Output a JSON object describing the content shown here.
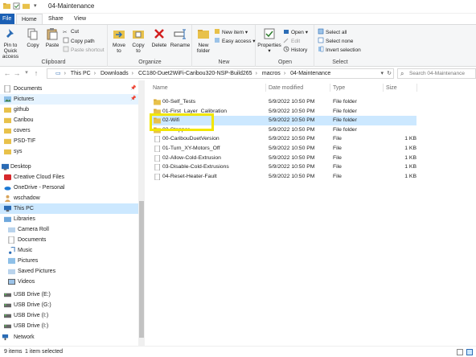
{
  "window": {
    "title": "04-Maintenance"
  },
  "tabs": [
    {
      "label": "File"
    },
    {
      "label": "Home"
    },
    {
      "label": "Share"
    },
    {
      "label": "View"
    }
  ],
  "ribbon": {
    "clipboard": {
      "label": "Clipboard",
      "pin": "Pin to Quick access",
      "copy": "Copy",
      "paste": "Paste",
      "cut": "Cut",
      "copy_path": "Copy path",
      "paste_shortcut": "Paste shortcut"
    },
    "organize": {
      "label": "Organize",
      "move_to": "Move to",
      "copy_to": "Copy to",
      "delete": "Delete",
      "rename": "Rename"
    },
    "new": {
      "label": "New",
      "new_folder": "New folder",
      "new_item": "New item",
      "easy_access": "Easy access"
    },
    "open": {
      "label": "Open",
      "properties": "Properties",
      "open": "Open",
      "edit": "Edit",
      "history": "History"
    },
    "select": {
      "label": "Select",
      "select_all": "Select all",
      "select_none": "Select none",
      "invert": "Invert selection"
    }
  },
  "address": {
    "crumbs": [
      "This PC",
      "Downloads",
      "CC180-Duet2WiFi-Caribou320-NSP-Build265",
      "macros",
      "04-Maintenance"
    ],
    "search_placeholder": "Search 04-Maintenance"
  },
  "nav": {
    "items": [
      {
        "label": "Documents",
        "icon": "documents-icon",
        "pinned": true
      },
      {
        "label": "Pictures",
        "icon": "pictures-icon",
        "pinned": true,
        "selected_light": true
      },
      {
        "label": "github",
        "icon": "folder-icon"
      },
      {
        "label": "Caribou",
        "icon": "folder-icon"
      },
      {
        "label": "covers",
        "icon": "folder-icon"
      },
      {
        "label": "PSD-TIF",
        "icon": "folder-icon"
      },
      {
        "label": "sys",
        "icon": "folder-icon"
      },
      {
        "label": "Desktop",
        "icon": "desktop-icon"
      },
      {
        "label": "Creative Cloud Files",
        "icon": "creative-cloud-icon"
      },
      {
        "label": "OneDrive - Personal",
        "icon": "onedrive-icon"
      },
      {
        "label": "wschadow",
        "icon": "user-icon"
      },
      {
        "label": "This PC",
        "icon": "pc-icon",
        "selected": true
      },
      {
        "label": "Libraries",
        "icon": "libraries-icon"
      },
      {
        "label": "Camera Roll",
        "icon": "library-folder-icon"
      },
      {
        "label": "Documents",
        "icon": "documents-icon"
      },
      {
        "label": "Music",
        "icon": "music-icon"
      },
      {
        "label": "Pictures",
        "icon": "pictures-icon"
      },
      {
        "label": "Saved Pictures",
        "icon": "library-folder-icon"
      },
      {
        "label": "Videos",
        "icon": "videos-icon"
      },
      {
        "label": "USB Drive (E:)",
        "icon": "usb-drive-icon"
      },
      {
        "label": "USB Drive (G:)",
        "icon": "usb-drive-icon"
      },
      {
        "label": "USB Drive (I:)",
        "icon": "usb-drive-icon"
      },
      {
        "label": "USB Drive (I:)",
        "icon": "usb-drive-icon"
      },
      {
        "label": "Network",
        "icon": "network-icon"
      }
    ]
  },
  "files": {
    "columns": {
      "name": "Name",
      "date": "Date modified",
      "type": "Type",
      "size": "Size"
    },
    "rows": [
      {
        "name": "00-Self_Tests",
        "date": "5/9/2022 10:50 PM",
        "type": "File folder",
        "size": "",
        "kind": "folder"
      },
      {
        "name": "01-First_Layer_Calibration",
        "date": "5/9/2022 10:50 PM",
        "type": "File folder",
        "size": "",
        "kind": "folder"
      },
      {
        "name": "02-Wifi",
        "date": "5/9/2022 10:50 PM",
        "type": "File folder",
        "size": "",
        "kind": "folder",
        "selected": true
      },
      {
        "name": "03-Stepper",
        "date": "5/9/2022 10:50 PM",
        "type": "File folder",
        "size": "",
        "kind": "folder"
      },
      {
        "name": "00-CaribouDuetVersion",
        "date": "5/9/2022 10:50 PM",
        "type": "File",
        "size": "1 KB",
        "kind": "file"
      },
      {
        "name": "01-Turn_XY-Motors_Off",
        "date": "5/9/2022 10:50 PM",
        "type": "File",
        "size": "1 KB",
        "kind": "file"
      },
      {
        "name": "02-Allow-Cold-Extrusion",
        "date": "5/9/2022 10:50 PM",
        "type": "File",
        "size": "1 KB",
        "kind": "file"
      },
      {
        "name": "03-Disable-Cold-Extrusions",
        "date": "5/9/2022 10:50 PM",
        "type": "File",
        "size": "1 KB",
        "kind": "file"
      },
      {
        "name": "04-Reset-Heater-Fault",
        "date": "5/9/2022 10:50 PM",
        "type": "File",
        "size": "1 KB",
        "kind": "file"
      }
    ]
  },
  "status": {
    "count": "9 items",
    "selected": "1 item selected"
  },
  "colors": {
    "accent": "#1a5fb4",
    "selection": "#cce8ff",
    "folder": "#e8c14a",
    "highlight": "#f2e600"
  }
}
